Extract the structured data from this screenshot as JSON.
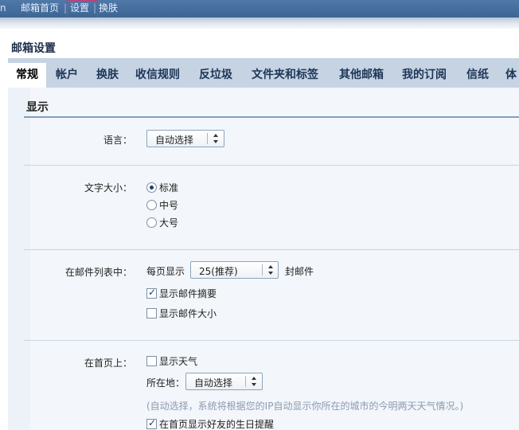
{
  "topnav": {
    "gripper": "n",
    "links": [
      "邮箱首页",
      "设置",
      "换肤"
    ],
    "separator": "|"
  },
  "page_title": "邮箱设置",
  "tabs": [
    "常规",
    "帐户",
    "换肤",
    "收信规则",
    "反垃圾",
    "文件夹和标签",
    "其他邮箱",
    "我的订阅",
    "信纸",
    "体"
  ],
  "active_tab": "常规",
  "section": {
    "title": "显示",
    "language": {
      "label": "语言：",
      "value": "自动选择"
    },
    "font_size": {
      "label": "文字大小：",
      "options": [
        {
          "label": "标准",
          "checked": true
        },
        {
          "label": "中号",
          "checked": false
        },
        {
          "label": "大号",
          "checked": false
        }
      ]
    },
    "mail_list": {
      "label": "在邮件列表中：",
      "per_page_prefix": "每页显示",
      "per_page_value": "25(推荐)",
      "per_page_suffix": "封邮件",
      "show_summary": {
        "label": "显示邮件摘要",
        "checked": true
      },
      "show_size": {
        "label": "显示邮件大小",
        "checked": false
      }
    },
    "home_page": {
      "label": "在首页上：",
      "show_weather": {
        "label": "显示天气",
        "checked": false
      },
      "location_label": "所在地：",
      "location_value": "自动选择",
      "location_hint": "(自动选择，系统将根据您的IP自动显示你所在的城市的今明两天天气情况。)",
      "show_birthday": {
        "label": "在首页显示好友的生日提醒",
        "checked": true
      }
    }
  },
  "colors": {
    "topbar": "#3d6594",
    "tabbar": "#c5d3e3",
    "focus_box": "#d2366b",
    "section_rule": "#7fa0c2"
  }
}
